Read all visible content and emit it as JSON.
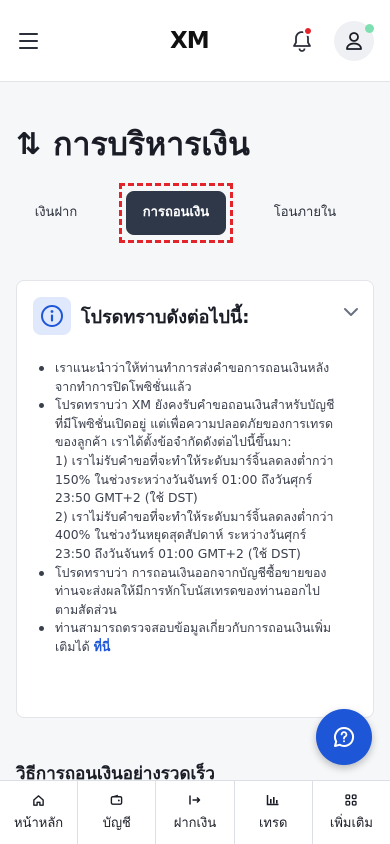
{
  "header": {
    "brand": "XM",
    "menu_icon": "hamburger-icon",
    "notification_icon": "bell-icon",
    "profile_icon": "user-icon"
  },
  "page": {
    "title_icon": "arrows-up-down-icon",
    "title": "การบริหารเงิน"
  },
  "tabs": [
    {
      "label": "เงินฝาก",
      "active": false
    },
    {
      "label": "การถอนเงิน",
      "active": true
    },
    {
      "label": "โอนภายใน",
      "active": false
    }
  ],
  "notice": {
    "icon": "info-icon",
    "title": "โปรดทราบดังต่อไปนี้:",
    "toggle_icon": "chevron-down-icon",
    "bullets": [
      {
        "lines": [
          "เราแนะนำว่าให้ท่านทำการส่งคำขอการถอนเงินหลัง",
          "จากทำการปิดโพซิชั่นแล้ว"
        ]
      },
      {
        "lines": [
          "โปรดทราบว่า XM ยังคงรับคำขอถอนเงินสำหรับบัญชี",
          "ที่มีโพซิชั่นเปิดอยู่ แต่เพื่อความปลอดภัยของการเทรด",
          "ของลูกค้า เราได้ตั้งข้อจำกัดดังต่อไปนี้ขึ้นมา:",
          "1) เราไม่รับคำขอที่จะทำให้ระดับมาร์จิ้นลดลงต่ำกว่า",
          "150% ในช่วงระหว่างวันจันทร์ 01:00 ถึงวันศุกร์",
          "23:50 GMT+2 (ใช้ DST)",
          "2) เราไม่รับคำขอที่จะทำให้ระดับมาร์จิ้นลดลงต่ำกว่า",
          "400% ในช่วงวันหยุดสุดสัปดาห์ ระหว่างวันศุกร์",
          "23:50 ถึงวันจันทร์ 01:00 GMT+2 (ใช้ DST)"
        ]
      },
      {
        "lines": [
          "โปรดทราบว่า การถอนเงินออกจากบัญชีซื้อขายของ",
          "ท่านจะส่งผลให้มีการหักโบนัสเทรดของท่านออกไป",
          "ตามสัดส่วน"
        ]
      },
      {
        "lines": [
          "ท่านสามารถตรวจสอบข้อมูลเกี่ยวกับการถอนเงินเพิ่ม",
          "เติมได้"
        ],
        "link": "ที่นี่"
      }
    ]
  },
  "section": {
    "title": "วิธีการถอนเงินอย่างรวดเร็ว"
  },
  "chat": {
    "icon": "chat-help-icon"
  },
  "bottom_nav": [
    {
      "label": "หน้าหลัก",
      "icon": "home-icon"
    },
    {
      "label": "บัญชี",
      "icon": "wallet-icon"
    },
    {
      "label": "ฝากเงิน",
      "icon": "deposit-arrow-icon"
    },
    {
      "label": "เทรด",
      "icon": "chart-icon"
    },
    {
      "label": "เพิ่มเติม",
      "icon": "grid-icon"
    }
  ]
}
